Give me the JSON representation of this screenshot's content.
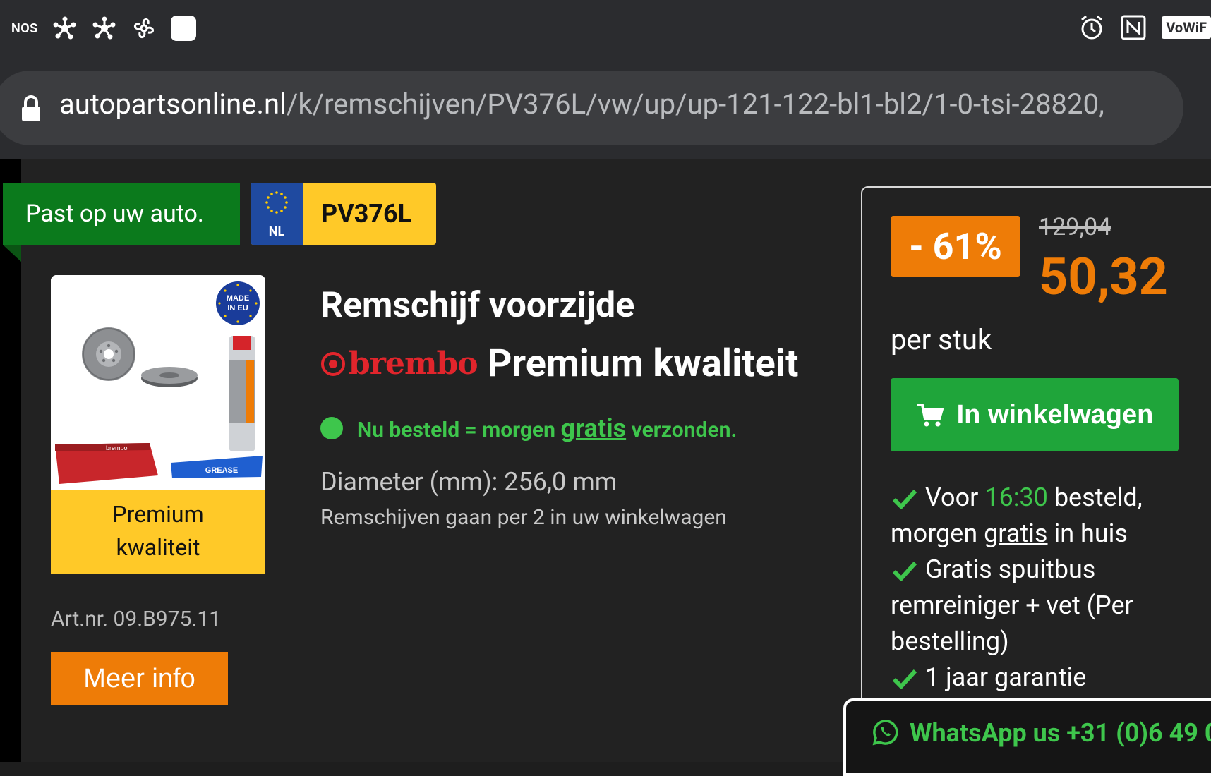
{
  "status_bar": {
    "carrier_label": "NOS",
    "left_icons": [
      "pinwheel-icon",
      "pinwheel-icon",
      "fan-icon",
      "app-square-icon"
    ],
    "right_icons": [
      "alarm-icon",
      "nfc-icon",
      "vowifi-icon"
    ],
    "vowifi_label": "VoWiF"
  },
  "browser": {
    "url_domain": "autopartsonline.nl",
    "url_path": "/k/remschijven/PV376L/vw/up/up-121-122-bl1-bl2/1-0-tsi-28820,"
  },
  "badges": {
    "fit_label": "Past op uw auto.",
    "plate_country": "NL",
    "plate_number": "PV376L"
  },
  "product": {
    "image_alt": "Brembo remschijven met remreiniger en vet",
    "image_made_in": "MADE IN EU",
    "image_grease": "GREASE",
    "card_label_line1": "Premium",
    "card_label_line2": "kwaliteit",
    "art_nr": "Art.nr. 09.B975.11",
    "more_info": "Meer info",
    "title": "Remschijf voorzijde",
    "brand": "brembo",
    "quality": "Premium kwaliteit",
    "ship_pre": "Nu besteld = morgen",
    "ship_gratis": "gratis",
    "ship_post": "verzonden.",
    "diameter": "Diameter (mm): 256,0 mm",
    "note": "Remschijven gaan per 2 in uw winkelwagen"
  },
  "pricing": {
    "discount": "- 61%",
    "old_price": "129,04",
    "new_price": "50,32",
    "unit": "per stuk",
    "cart_button": "In winkelwagen",
    "usp1_a": "Voor",
    "usp1_time": "16:30",
    "usp1_b": "besteld, morgen",
    "usp1_gratis": "gratis",
    "usp1_c": "in huis",
    "usp2": "Gratis spuitbus remreiniger + vet (Per bestelling)",
    "usp3": "1 jaar garantie"
  },
  "whatsapp": {
    "label": "WhatsApp us +31 (0)6 49 0"
  },
  "colors": {
    "accent_orange": "#ee7c07",
    "green_badge": "#0b7a1c",
    "green_button": "#1fa53a",
    "green_text": "#3ec64c",
    "plate_yellow": "#ffc928"
  }
}
